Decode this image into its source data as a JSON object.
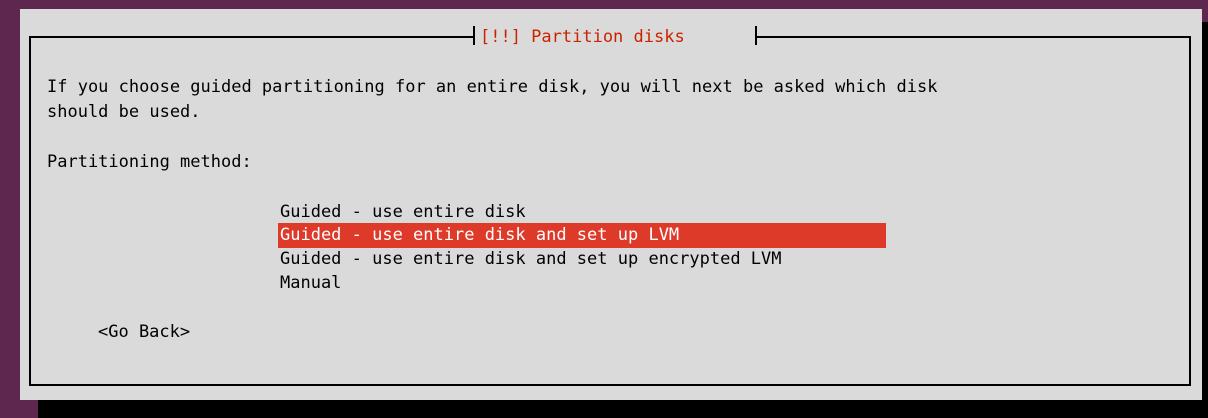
{
  "colors": {
    "background": "#5e2750",
    "dialog": "#dadada",
    "highlight": "#dd3a2a",
    "title": "#cc2200"
  },
  "dialog": {
    "title": "[!!] Partition disks",
    "description_line1": "If you choose guided partitioning for an entire disk, you will next be asked which disk",
    "description_line2": "should be used.",
    "prompt": "Partitioning method:",
    "options": [
      "Guided - use entire disk",
      "Guided - use entire disk and set up LVM",
      "Guided - use entire disk and set up encrypted LVM",
      "Manual"
    ],
    "selected_option": "Guided - use entire disk and set up LVM",
    "back_button": "<Go Back>"
  }
}
